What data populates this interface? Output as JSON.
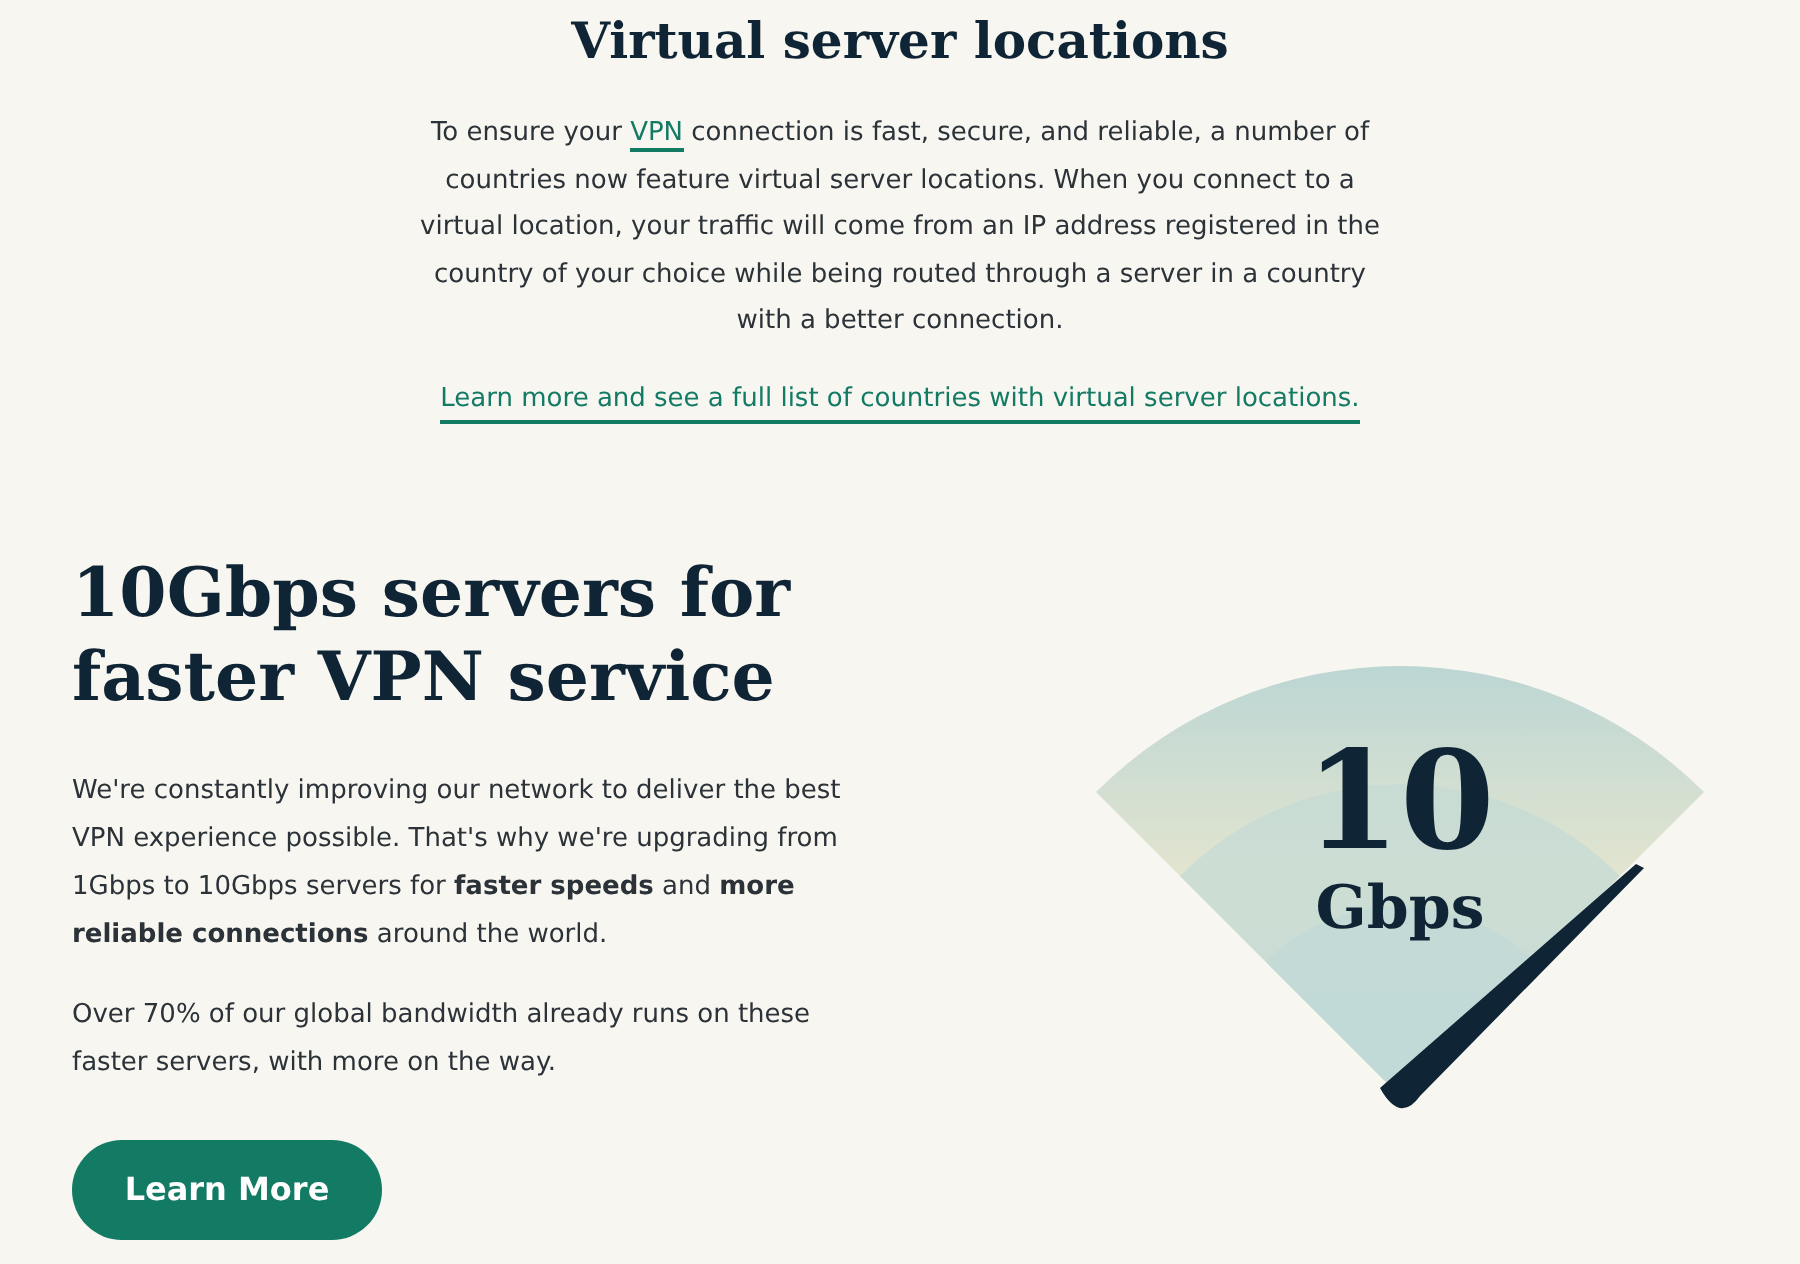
{
  "virtual_section": {
    "title": "Virtual server locations",
    "intro": {
      "before": "To ensure your ",
      "link": "VPN",
      "after": " connection is fast, secure, and reliable, a number of countries now feature virtual server locations. When you connect to a virtual location, your traffic will come from an IP address registered in the country of your choice while being routed through a server in a country with a better connection."
    },
    "more_link": "Learn more and see a full list of countries with virtual server locations."
  },
  "speed_section": {
    "title": "10Gbps servers for faster VPN service",
    "paragraphs": [
      "We're constantly improving our network to deliver the best VPN experience possible. That's why we're upgrading from 1Gbps to 10Gbps servers for **faster speeds** and **more reliable connections** around the world.",
      "Over 70% of our global bandwidth already runs on these faster servers, with more on the way."
    ],
    "button": "Learn More",
    "gauge": {
      "value": "10",
      "unit": "Gbps"
    }
  }
}
